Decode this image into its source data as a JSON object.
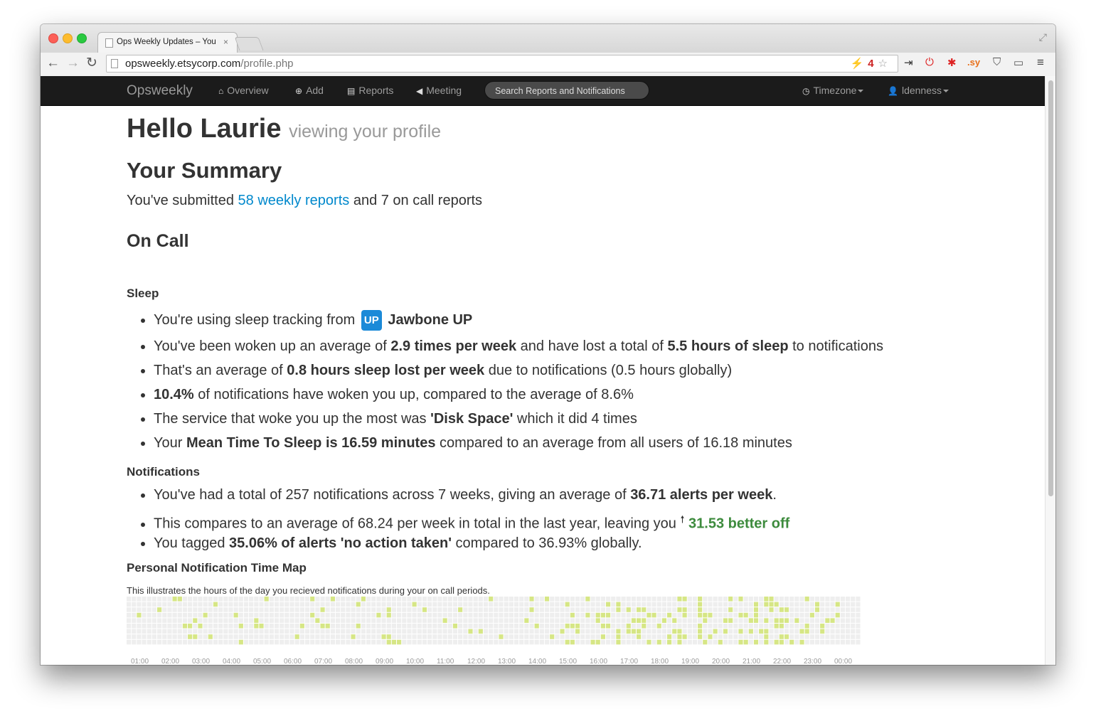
{
  "browser": {
    "tab_title": "Ops Weekly Updates – You",
    "tab_close": "×",
    "url_host": "opsweekly.etsycorp.com",
    "url_path": "/profile.php",
    "extension_badge": "4",
    "extension_sy": ".sy",
    "icons": [
      "back-icon",
      "forward-icon",
      "reload-icon",
      "bookmark-star-icon",
      "menu-icon"
    ]
  },
  "nav": {
    "brand": "Opsweekly",
    "items": [
      {
        "label": "Overview",
        "icon": "home-icon",
        "glyph": "⌂"
      },
      {
        "label": "Add",
        "icon": "plus-circle-icon",
        "glyph": "⊕"
      },
      {
        "label": "Reports",
        "icon": "list-icon",
        "glyph": "▤"
      },
      {
        "label": "Meeting",
        "icon": "bullhorn-icon",
        "glyph": "◀"
      }
    ],
    "search_placeholder": "Search Reports and Notifications",
    "timezone": "Timezone",
    "user": "ldenness"
  },
  "page": {
    "greeting": "Hello Laurie",
    "greeting_sub": "viewing your profile",
    "summary_heading": "Your Summary",
    "summary": {
      "prefix": "You've submitted ",
      "link": "58 weekly reports",
      "suffix": " and 7 on call reports"
    },
    "oncall_heading": "On Call",
    "sleep_heading": "Sleep",
    "sleep": {
      "tracking_prefix": "You're using sleep tracking from",
      "tracking_logo": "UP",
      "tracking_name": "Jawbone UP",
      "woken_1": "You've been woken up an average of ",
      "woken_b1": "2.9 times per week",
      "woken_2": " and have lost a total of ",
      "woken_b2": "5.5 hours of sleep",
      "woken_3": " to notifications",
      "avg_1": "That's an average of ",
      "avg_b": "0.8 hours sleep lost per week",
      "avg_2": " due to notifications (0.5 hours globally)",
      "pct_b": "10.4%",
      "pct_2": " of notifications have woken you up, compared to the average of 8.6%",
      "svc_1": "The service that woke you up the most was ",
      "svc_b": "'Disk Space'",
      "svc_2": " which it did 4 times",
      "mtts_1": "Your ",
      "mtts_b": "Mean Time To Sleep is 16.59 minutes",
      "mtts_2": " compared to an average from all users of 16.18 minutes"
    },
    "notifications_heading": "Notifications",
    "notifications": {
      "total_1": "You've had a total of 257 notifications across 7 weeks, giving an average of ",
      "total_b": "36.71 alerts per week",
      "total_2": ".",
      "cmp_1": "This compares to an average of 68.24 per week in total in the last year, leaving you ",
      "cmp_arrow": "🠕",
      "cmp_b": "31.53 better off",
      "tag_1": "You tagged ",
      "tag_b": "35.06% of alerts 'no action taken'",
      "tag_2": " compared to 36.93% globally."
    },
    "map_title": "Personal Notification Time Map",
    "map_desc": "This illustrates the hours of the day you recieved notifications during your on call periods.",
    "map_colors": {
      "empty": "#eeeeee",
      "active": "#d6e685"
    },
    "hour_labels": [
      "01:00",
      "02:00",
      "03:00",
      "04:00",
      "05:00",
      "06:00",
      "07:00",
      "08:00",
      "09:00",
      "10:00",
      "11:00",
      "12:00",
      "13:00",
      "14:00",
      "15:00",
      "16:00",
      "17:00",
      "18:00",
      "19:00",
      "20:00",
      "21:00",
      "22:00",
      "23:00",
      "00:00"
    ]
  }
}
